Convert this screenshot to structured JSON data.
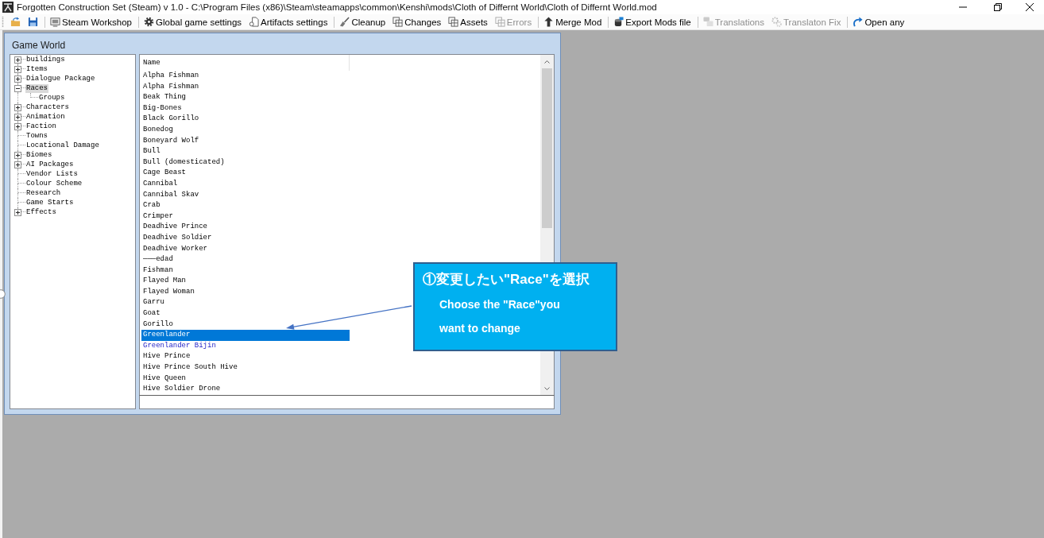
{
  "window": {
    "title": "Forgotten Construction Set (Steam) v 1.0 - C:\\Program Files (x86)\\Steam\\steamapps\\common\\Kenshi\\mods\\Cloth of Differnt World\\Cloth of Differnt World.mod"
  },
  "toolbar": {
    "groups": [
      {
        "buttons": [
          {
            "disabled": false
          },
          {
            "disabled": false
          }
        ]
      },
      {
        "buttons": [
          {
            "label": "Steam Workshop",
            "disabled": false
          }
        ]
      },
      {
        "buttons": [
          {
            "label": "Global game settings",
            "disabled": false
          },
          {
            "label": "Artifacts settings",
            "disabled": false
          }
        ]
      },
      {
        "buttons": [
          {
            "label": "Cleanup",
            "disabled": false
          },
          {
            "label": "Changes",
            "disabled": false
          },
          {
            "label": "Assets",
            "disabled": false
          },
          {
            "label": "Errors",
            "disabled": true
          }
        ]
      },
      {
        "buttons": [
          {
            "label": "Merge Mod",
            "disabled": false
          }
        ]
      },
      {
        "buttons": [
          {
            "label": "Export Mods file",
            "disabled": false
          }
        ]
      },
      {
        "buttons": [
          {
            "label": "Translations",
            "disabled": true
          },
          {
            "label": "Translaton Fix",
            "disabled": true
          }
        ]
      },
      {
        "buttons": [
          {
            "label": "Open any",
            "disabled": false
          }
        ]
      }
    ]
  },
  "game_world": {
    "title": "Game World",
    "tree": [
      {
        "label": "buildings",
        "kind": "branch",
        "expanded": false,
        "selected": false
      },
      {
        "label": "Items",
        "kind": "branch",
        "expanded": false,
        "selected": false
      },
      {
        "label": "Dialogue Package",
        "kind": "branch",
        "expanded": false,
        "selected": false
      },
      {
        "label": "Races",
        "kind": "branch",
        "expanded": true,
        "selected": true,
        "children": [
          {
            "label": "Groups",
            "kind": "leaf",
            "expanded": false,
            "selected": false
          }
        ]
      },
      {
        "label": "Characters",
        "kind": "branch",
        "expanded": false,
        "selected": false
      },
      {
        "label": "Animation",
        "kind": "branch",
        "expanded": false,
        "selected": false
      },
      {
        "label": "Faction",
        "kind": "branch",
        "expanded": false,
        "selected": false
      },
      {
        "label": "Towns",
        "kind": "leaf",
        "expanded": false,
        "selected": false
      },
      {
        "label": "Locational Damage",
        "kind": "leaf",
        "expanded": false,
        "selected": false
      },
      {
        "label": "Biomes",
        "kind": "branch",
        "expanded": false,
        "selected": false
      },
      {
        "label": "AI Packages",
        "kind": "branch",
        "expanded": false,
        "selected": false
      },
      {
        "label": "Vendor Lists",
        "kind": "leaf",
        "expanded": false,
        "selected": false
      },
      {
        "label": "Colour Scheme",
        "kind": "leaf",
        "expanded": false,
        "selected": false
      },
      {
        "label": "Research",
        "kind": "leaf",
        "expanded": false,
        "selected": false
      },
      {
        "label": "Game Starts",
        "kind": "leaf",
        "expanded": false,
        "selected": false
      },
      {
        "label": "Effects",
        "kind": "branch",
        "expanded": false,
        "selected": false
      }
    ],
    "list": {
      "columns": [
        "Name"
      ],
      "rows": [
        {
          "name": "Alpha Fishman",
          "selected": false,
          "modified": false
        },
        {
          "name": "Alpha Fishman",
          "selected": false,
          "modified": false
        },
        {
          "name": "Beak Thing",
          "selected": false,
          "modified": false
        },
        {
          "name": "Big-Bones",
          "selected": false,
          "modified": false
        },
        {
          "name": "Black Gorillo",
          "selected": false,
          "modified": false
        },
        {
          "name": "Bonedog",
          "selected": false,
          "modified": false
        },
        {
          "name": "Boneyard Wolf",
          "selected": false,
          "modified": false
        },
        {
          "name": "Bull",
          "selected": false,
          "modified": false
        },
        {
          "name": "Bull (domesticated)",
          "selected": false,
          "modified": false
        },
        {
          "name": "Cage Beast",
          "selected": false,
          "modified": false
        },
        {
          "name": "Cannibal",
          "selected": false,
          "modified": false
        },
        {
          "name": "Cannibal Skav",
          "selected": false,
          "modified": false
        },
        {
          "name": "Crab",
          "selected": false,
          "modified": false
        },
        {
          "name": "Crimper",
          "selected": false,
          "modified": false
        },
        {
          "name": "Deadhive Prince",
          "selected": false,
          "modified": false
        },
        {
          "name": "Deadhive Soldier",
          "selected": false,
          "modified": false
        },
        {
          "name": "Deadhive Worker",
          "selected": false,
          "modified": false
        },
        {
          "name": "———edad",
          "selected": false,
          "modified": false
        },
        {
          "name": "Fishman",
          "selected": false,
          "modified": false
        },
        {
          "name": "Flayed Man",
          "selected": false,
          "modified": false
        },
        {
          "name": "Flayed Woman",
          "selected": false,
          "modified": false
        },
        {
          "name": "Garru",
          "selected": false,
          "modified": false
        },
        {
          "name": "Goat",
          "selected": false,
          "modified": false
        },
        {
          "name": "Gorillo",
          "selected": false,
          "modified": false
        },
        {
          "name": "Greenlander",
          "selected": true,
          "modified": false
        },
        {
          "name": "Greenlander Bijin",
          "selected": false,
          "modified": true
        },
        {
          "name": "Hive Prince",
          "selected": false,
          "modified": false
        },
        {
          "name": "Hive Prince South Hive",
          "selected": false,
          "modified": false
        },
        {
          "name": "Hive Queen",
          "selected": false,
          "modified": false
        },
        {
          "name": "Hive Soldier Drone",
          "selected": false,
          "modified": false
        }
      ]
    }
  },
  "annotation": {
    "title": "①変更したい\"Race\"を選択",
    "text": "Choose the \"Race\"you want to change"
  }
}
